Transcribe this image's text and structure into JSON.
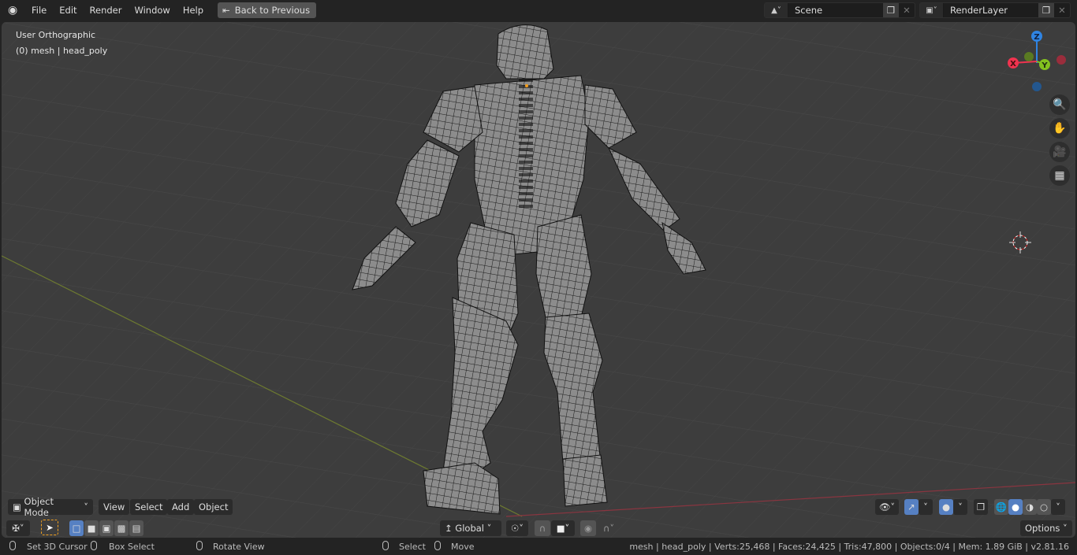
{
  "menu": {
    "items": [
      "File",
      "Edit",
      "Render",
      "Window",
      "Help"
    ],
    "back_button": "Back to Previous"
  },
  "scene": {
    "name": "Scene"
  },
  "render_layer": {
    "name": "RenderLayer"
  },
  "viewport": {
    "view_name": "User Orthographic",
    "object_info": "(0) mesh | head_poly",
    "gizmo": {
      "x": "X",
      "y": "Y",
      "z": "Z",
      "x_color": "#f0334f",
      "y_color": "#83c21f",
      "z_color": "#2f84e3"
    }
  },
  "header": {
    "mode": "Object Mode",
    "menus": [
      "View",
      "Select",
      "Add",
      "Object"
    ],
    "transform_orientation": "Global",
    "options": "Options"
  },
  "statusbar": {
    "left": [
      "Set 3D Cursor",
      "Box Select",
      "Rotate View",
      "Select",
      "Move"
    ],
    "stats": "mesh | head_poly | Verts:25,468 | Faces:24,425 | Tris:47,800 | Objects:0/4 | Mem: 1.89 GiB | v2.81.16"
  }
}
